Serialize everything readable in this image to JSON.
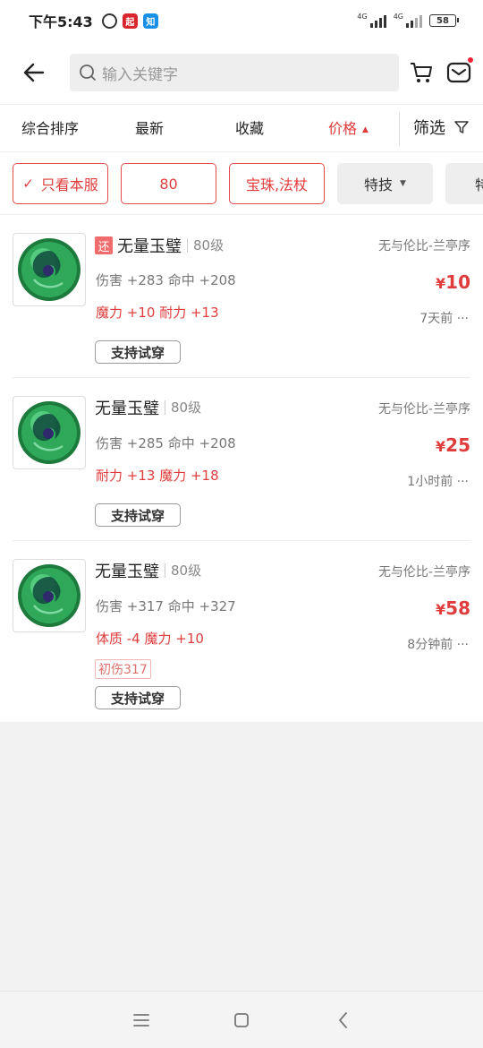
{
  "status_bar": {
    "time": "下午5:43",
    "badge_qi": "起",
    "badge_zhi": "知",
    "net1": "4G",
    "net2": "4G",
    "battery": "58"
  },
  "header": {
    "search_placeholder": "输入关键字"
  },
  "sort_tabs": [
    {
      "label": "综合排序"
    },
    {
      "label": "最新"
    },
    {
      "label": "收藏"
    },
    {
      "label": "价格",
      "active": true
    }
  ],
  "filter_label": "筛选",
  "chips": [
    {
      "label": "只看本服",
      "checked": true
    },
    {
      "label": "80"
    },
    {
      "label": "宝珠,法杖"
    },
    {
      "label": "特技"
    },
    {
      "label": "特"
    }
  ],
  "items": [
    {
      "badge": "还",
      "name": "无量玉璧",
      "level": "80级",
      "stats": "伤害 +283 命中 +208",
      "extra": "魔力 +10 耐力 +13",
      "server": "无与伦比-兰亭序",
      "currency": "¥",
      "price": "10",
      "time": "7天前 ···",
      "tag": "",
      "tryon": "支持试穿"
    },
    {
      "badge": "",
      "name": "无量玉璧",
      "level": "80级",
      "stats": "伤害 +285 命中 +208",
      "extra": "耐力 +13 魔力 +18",
      "server": "无与伦比-兰亭序",
      "currency": "¥",
      "price": "25",
      "time": "1小时前 ···",
      "tag": "",
      "tryon": "支持试穿"
    },
    {
      "badge": "",
      "name": "无量玉璧",
      "level": "80级",
      "stats": "伤害 +317 命中 +327",
      "extra": "体质 -4 魔力 +10",
      "server": "无与伦比-兰亭序",
      "currency": "¥",
      "price": "58",
      "time": "8分钟前 ···",
      "tag": "初伤317",
      "tryon": "支持试穿"
    }
  ],
  "colors": {
    "accent": "#e03c3c",
    "gem_green": "#2fa85a"
  }
}
